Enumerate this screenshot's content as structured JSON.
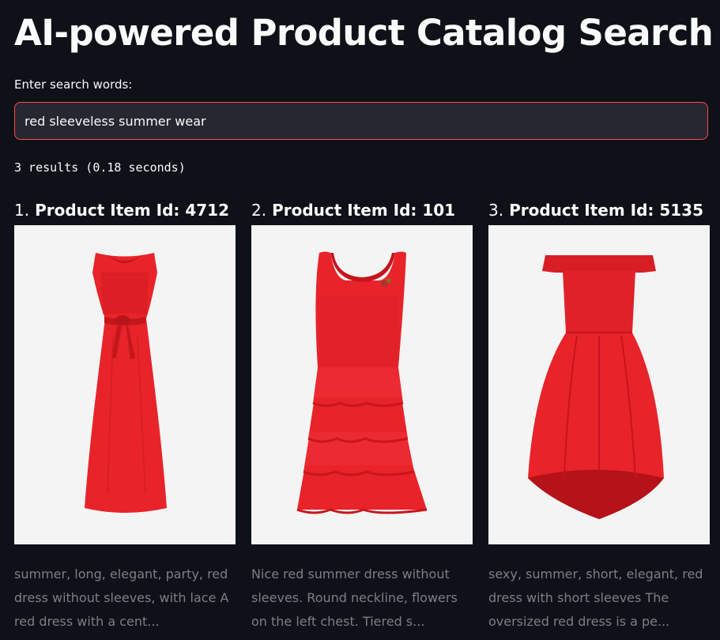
{
  "page": {
    "title": "AI-powered Product Catalog Search"
  },
  "search": {
    "label": "Enter search words:",
    "value": "red sleeveless summer wear"
  },
  "results": {
    "summary": "3 results (0.18 seconds)",
    "items": [
      {
        "rank": "1.",
        "heading": "Product Item Id: 4712",
        "image_icon": "red-long-dress-image",
        "description": "summer, long, elegant, party, red dress without sleeves, with lace A red dress with a cent..."
      },
      {
        "rank": "2.",
        "heading": "Product Item Id: 101",
        "image_icon": "red-tiered-dress-image",
        "description": "Nice red summer dress without sleeves. Round neckline, flowers on the left chest. Tiered s..."
      },
      {
        "rank": "3.",
        "heading": "Product Item Id: 5135",
        "image_icon": "red-off-shoulder-dress-image",
        "description": "sexy, summer, short, elegant, red dress with short sleeves The oversized red dress is a pe..."
      }
    ]
  },
  "colors": {
    "background": "#0e1117",
    "accent": "#ff4b4b",
    "input_bg": "#262730",
    "muted_text": "#7d7f85",
    "dress_red": "#e8232a"
  }
}
